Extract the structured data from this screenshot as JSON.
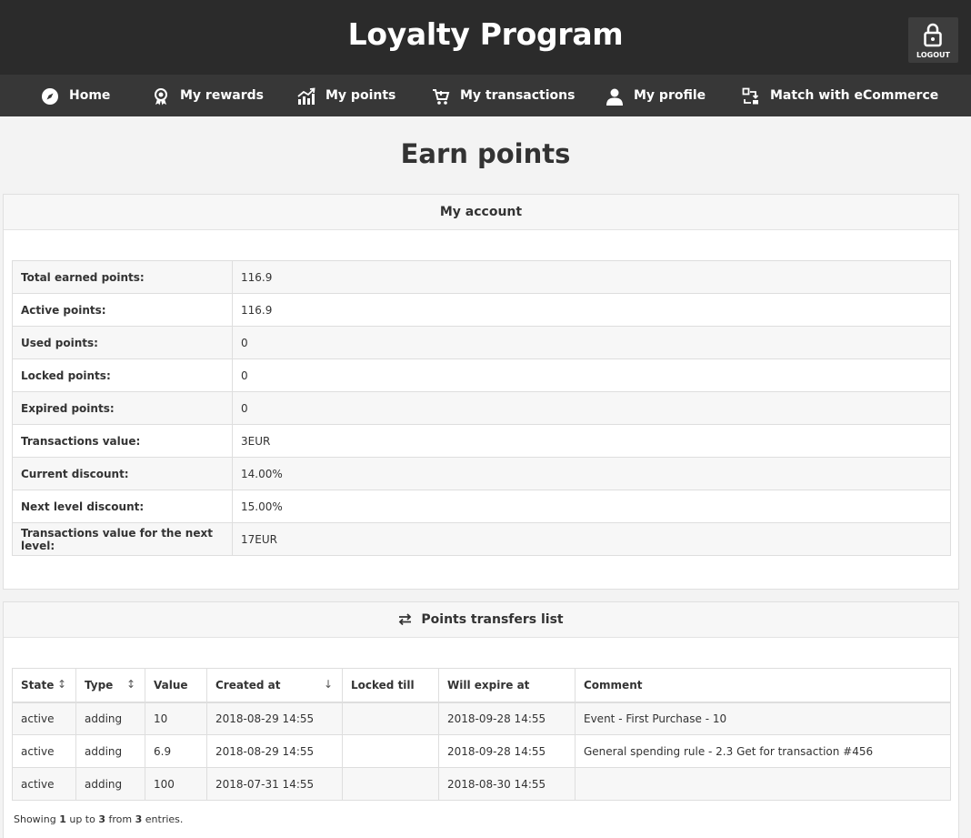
{
  "header": {
    "title": "Loyalty Program",
    "logout_label": "LOGOUT"
  },
  "nav": [
    {
      "label": "Home",
      "icon": "compass-icon"
    },
    {
      "label": "My rewards",
      "icon": "award-icon"
    },
    {
      "label": "My points",
      "icon": "chart-icon"
    },
    {
      "label": "My transactions",
      "icon": "cart-icon"
    },
    {
      "label": "My profile",
      "icon": "user-icon"
    },
    {
      "label": "Match with eCommerce",
      "icon": "match-icon"
    }
  ],
  "page_title": "Earn points",
  "account": {
    "title": "My account",
    "rows": [
      {
        "label": "Total earned points:",
        "value": "116.9"
      },
      {
        "label": "Active points:",
        "value": "116.9"
      },
      {
        "label": "Used points:",
        "value": "0"
      },
      {
        "label": "Locked points:",
        "value": "0"
      },
      {
        "label": "Expired points:",
        "value": "0"
      },
      {
        "label": "Transactions value:",
        "value": "3EUR"
      },
      {
        "label": "Current discount:",
        "value": "14.00%"
      },
      {
        "label": "Next level discount:",
        "value": "15.00%"
      },
      {
        "label": "Transactions value for the next level:",
        "value": "17EUR"
      }
    ]
  },
  "transfers": {
    "title": "Points transfers list",
    "columns": [
      "State",
      "Type",
      "Value",
      "Created at",
      "Locked till",
      "Will expire at",
      "Comment"
    ],
    "rows": [
      [
        "active",
        "adding",
        "10",
        "2018-08-29 14:55",
        "",
        "2018-09-28 14:55",
        "Event - First Purchase - 10"
      ],
      [
        "active",
        "adding",
        "6.9",
        "2018-08-29 14:55",
        "",
        "2018-09-28 14:55",
        "General spending rule - 2.3 Get for transaction #456"
      ],
      [
        "active",
        "adding",
        "100",
        "2018-07-31 14:55",
        "",
        "2018-08-30 14:55",
        ""
      ]
    ],
    "summary": {
      "prefix": "Showing",
      "from": "1",
      "mid1": "up to",
      "to": "3",
      "mid2": "from",
      "total": "3",
      "suffix": "entries."
    }
  }
}
